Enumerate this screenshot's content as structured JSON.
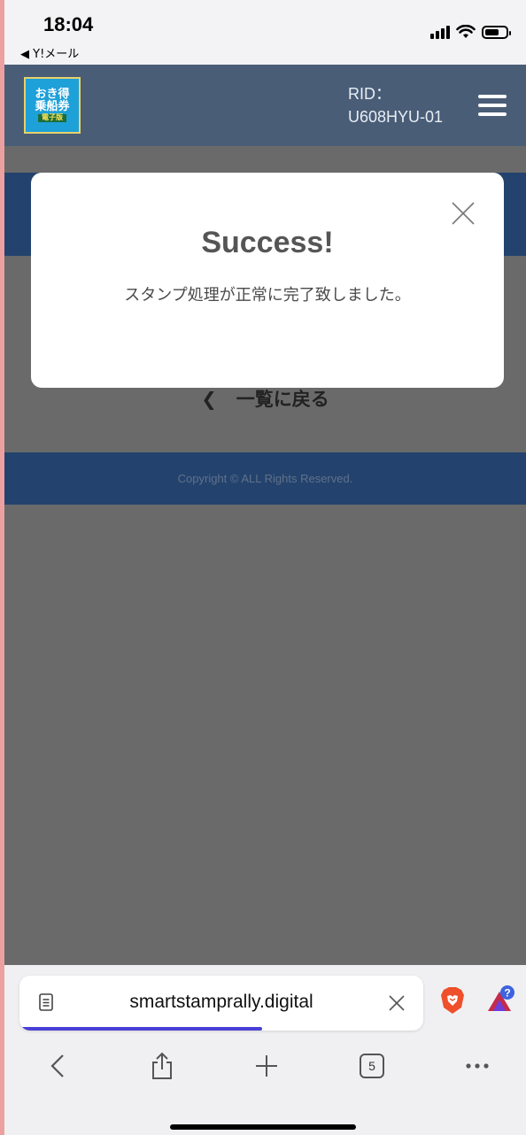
{
  "status_bar": {
    "time": "18:04",
    "back_app": "◀ Y!メール"
  },
  "site": {
    "logo": {
      "line1": "おき得",
      "line2": "乗船券",
      "line3": "電子版"
    },
    "rid_label": "RID：",
    "rid_value": "U608HYU-01",
    "back_link": "一覧に戻る",
    "back_chevron": "❮",
    "copyright": "Copyright © ALL Rights Reserved."
  },
  "modal": {
    "title": "Success!",
    "message": "スタンプ処理が正常に完了致しました。"
  },
  "browser": {
    "url": "smartstamprally.digital",
    "load_progress": 0.6,
    "tab_count": "5",
    "rewards_badge": "?",
    "accent_color": "#4a3fd6"
  },
  "colors": {
    "header_bg": "#4a5d77",
    "band_bg": "#23436e",
    "overlay_bg": "#6a6a6a"
  }
}
